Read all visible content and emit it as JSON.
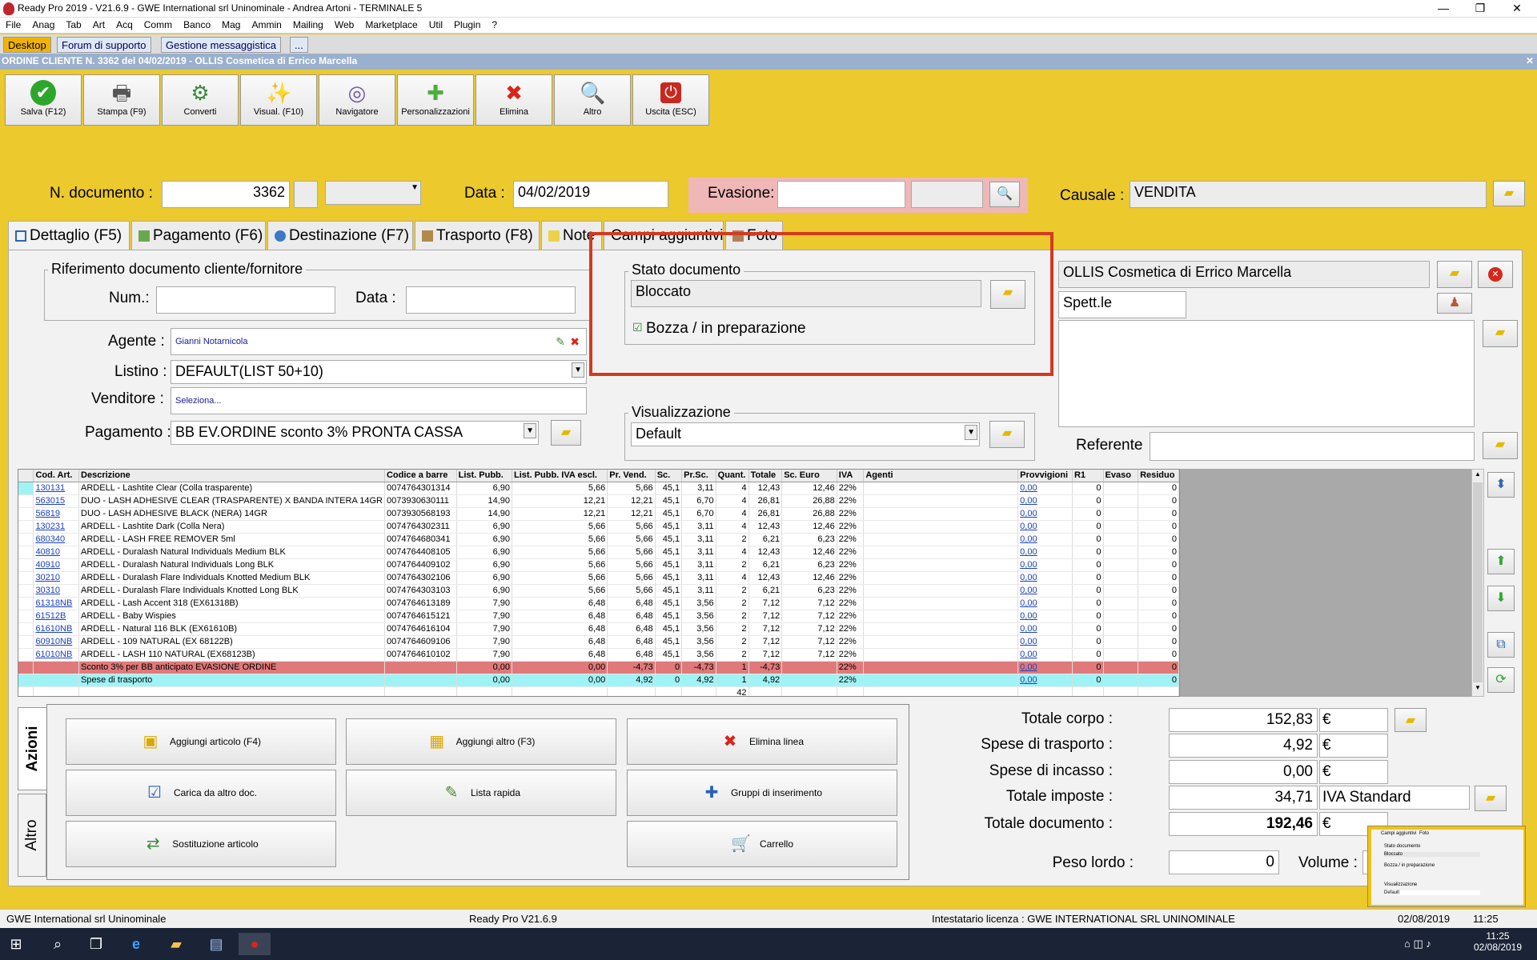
{
  "window": {
    "title": "Ready Pro 2019 - V21.6.9 - GWE International srl Uninominale - Andrea Artoni - TERMINALE 5",
    "min": "—",
    "max": "❐",
    "close": "✕"
  },
  "menu": [
    "File",
    "Anag",
    "Tab",
    "Art",
    "Acq",
    "Comm",
    "Banco",
    "Mag",
    "Ammin",
    "Mailing",
    "Web",
    "Marketplace",
    "Util",
    "Plugin",
    "?"
  ],
  "top_tabs": [
    "Desktop",
    "Forum di supporto",
    "Gestione messaggistica",
    "..."
  ],
  "order_title": "ORDINE CLIENTE N. 3362 del 04/02/2019 - OLLIS Cosmetica di Errico Marcella",
  "order_close": "✕",
  "toolbar": [
    {
      "label": "Salva (F12)",
      "icon": "✔"
    },
    {
      "label": "Stampa (F9)",
      "icon": "🖶"
    },
    {
      "label": "Converti",
      "icon": "⚙"
    },
    {
      "label": "Visual. (F10)",
      "icon": "✨"
    },
    {
      "label": "Navigatore",
      "icon": "◎"
    },
    {
      "label": "Personalizzazioni",
      "icon": "✚"
    },
    {
      "label": "Elimina",
      "icon": "✖"
    },
    {
      "label": "Altro",
      "icon": "🔍"
    },
    {
      "label": "Uscita (ESC)",
      "icon": "⏻"
    }
  ],
  "header": {
    "ndoc_label": "N. documento :",
    "ndoc_value": "3362",
    "data_label": "Data :",
    "data_value": "04/02/2019",
    "evasione_label": "Evasione:",
    "causale_label": "Causale :",
    "causale_value": "VENDITA"
  },
  "form_tabs": [
    "Dettaglio (F5)",
    "Pagamento (F6)",
    "Destinazione (F7)",
    "Trasporto (F8)",
    "Note",
    "Campi aggiuntivi",
    "Foto"
  ],
  "riferimento": {
    "title": "Riferimento documento cliente/fornitore",
    "num_label": "Num.:",
    "data_label": "Data :"
  },
  "agente": {
    "label": "Agente :",
    "value": "Gianni Notarnicola"
  },
  "listino": {
    "label": "Listino :",
    "value": "DEFAULT(LIST 50+10)"
  },
  "venditore": {
    "label": "Venditore :",
    "value": "Seleziona..."
  },
  "pagamento": {
    "label": "Pagamento :",
    "value": "BB EV.ORDINE sconto 3% PRONTA CASSA"
  },
  "stato": {
    "title": "Stato documento",
    "value": "Bloccato",
    "checkbox_label": "Bozza / in preparazione",
    "checkbox_mark": "☑"
  },
  "visualizzazione": {
    "title": "Visualizzazione",
    "value": "Default"
  },
  "cliente": {
    "name": "OLLIS Cosmetica di Errico Marcella",
    "title": "Spett.le",
    "referente_label": "Referente"
  },
  "grid": {
    "columns": [
      "",
      "Cod. Art.",
      "Descrizione",
      "Codice a barre",
      "List. Pubb.",
      "List. Pubb. IVA escl.",
      "Pr. Vend.",
      "Sc.",
      "Pr.Sc.",
      "Quant.",
      "Totale",
      "Sc. Euro",
      "IVA",
      "Agenti",
      "Provvigioni",
      "R1",
      "Evaso",
      "Residuo"
    ],
    "rows": [
      [
        "130131",
        "ARDELL - Lashtite Clear (Colla trasparente)",
        "0074764301314",
        "6,90",
        "5,66",
        "5,66",
        "45,1",
        "3,11",
        "4",
        "12,43",
        "12,46",
        "22%",
        "",
        "0,00",
        "0",
        "",
        "0"
      ],
      [
        "563015",
        "DUO - LASH ADHESIVE CLEAR (TRASPARENTE) X BANDA INTERA 14GR",
        "0073930630111",
        "14,90",
        "12,21",
        "12,21",
        "45,1",
        "6,70",
        "4",
        "26,81",
        "26,88",
        "22%",
        "",
        "0,00",
        "0",
        "",
        "0"
      ],
      [
        "56819",
        "DUO - LASH ADHESIVE BLACK (NERA) 14GR",
        "0073930568193",
        "14,90",
        "12,21",
        "12,21",
        "45,1",
        "6,70",
        "4",
        "26,81",
        "26,88",
        "22%",
        "",
        "0,00",
        "0",
        "",
        "0"
      ],
      [
        "130231",
        "ARDELL - Lashtite Dark (Colla Nera)",
        "0074764302311",
        "6,90",
        "5,66",
        "5,66",
        "45,1",
        "3,11",
        "4",
        "12,43",
        "12,46",
        "22%",
        "",
        "0,00",
        "0",
        "",
        "0"
      ],
      [
        "680340",
        "ARDELL - LASH FREE REMOVER 5ml",
        "0074764680341",
        "6,90",
        "5,66",
        "5,66",
        "45,1",
        "3,11",
        "2",
        "6,21",
        "6,23",
        "22%",
        "",
        "0,00",
        "0",
        "",
        "0"
      ],
      [
        "40810",
        "ARDELL - Duralash Natural Individuals Medium BLK",
        "0074764408105",
        "6,90",
        "5,66",
        "5,66",
        "45,1",
        "3,11",
        "4",
        "12,43",
        "12,46",
        "22%",
        "",
        "0,00",
        "0",
        "",
        "0"
      ],
      [
        "40910",
        "ARDELL - Duralash Natural Individuals  Long BLK",
        "0074764409102",
        "6,90",
        "5,66",
        "5,66",
        "45,1",
        "3,11",
        "2",
        "6,21",
        "6,23",
        "22%",
        "",
        "0,00",
        "0",
        "",
        "0"
      ],
      [
        "30210",
        "ARDELL - Duralash Flare Individuals Knotted Medium BLK",
        "0074764302106",
        "6,90",
        "5,66",
        "5,66",
        "45,1",
        "3,11",
        "4",
        "12,43",
        "12,46",
        "22%",
        "",
        "0,00",
        "0",
        "",
        "0"
      ],
      [
        "30310",
        "ARDELL - Duralash Flare Individuals Knotted Long BLK",
        "0074764303103",
        "6,90",
        "5,66",
        "5,66",
        "45,1",
        "3,11",
        "2",
        "6,21",
        "6,23",
        "22%",
        "",
        "0,00",
        "0",
        "",
        "0"
      ],
      [
        "61318NB",
        "ARDELL - Lash Accent 318 (EX61318B)",
        "0074764613189",
        "7,90",
        "6,48",
        "6,48",
        "45,1",
        "3,56",
        "2",
        "7,12",
        "7,12",
        "22%",
        "",
        "0,00",
        "0",
        "",
        "0"
      ],
      [
        "61512B",
        "ARDELL - Baby Wispies",
        "0074764615121",
        "7,90",
        "6,48",
        "6,48",
        "45,1",
        "3,56",
        "2",
        "7,12",
        "7,12",
        "22%",
        "",
        "0,00",
        "0",
        "",
        "0"
      ],
      [
        "61610NB",
        "ARDELL - Natural 116 BLK (EX61610B)",
        "0074764616104",
        "7,90",
        "6,48",
        "6,48",
        "45,1",
        "3,56",
        "2",
        "7,12",
        "7,12",
        "22%",
        "",
        "0,00",
        "0",
        "",
        "0"
      ],
      [
        "60910NB",
        "ARDELL - 109 NATURAL (EX 68122B)",
        "0074764609106",
        "7,90",
        "6,48",
        "6,48",
        "45,1",
        "3,56",
        "2",
        "7,12",
        "7,12",
        "22%",
        "",
        "0,00",
        "0",
        "",
        "0"
      ],
      [
        "61010NB",
        "ARDELL - LASH 110 NATURAL (EX68123B)",
        "0074764610102",
        "7,90",
        "6,48",
        "6,48",
        "45,1",
        "3,56",
        "2",
        "7,12",
        "7,12",
        "22%",
        "",
        "0,00",
        "0",
        "",
        "0"
      ]
    ],
    "sconto_row": [
      "",
      "Sconto 3% per BB anticipato EVASIONE ORDINE",
      "",
      "0,00",
      "0,00",
      "-4,73",
      "0",
      "-4,73",
      "1",
      "-4,73",
      "",
      "22%",
      "",
      "0,00",
      "0",
      "",
      "0"
    ],
    "spese_row": [
      "",
      "Spese di trasporto",
      "",
      "0,00",
      "0,00",
      "4,92",
      "0",
      "4,92",
      "1",
      "4,92",
      "",
      "22%",
      "",
      "0,00",
      "0",
      "",
      "0"
    ],
    "total_quant": "42"
  },
  "azioni": {
    "tab_label": "Azioni",
    "altro_label": "Altro",
    "buttons": [
      {
        "label": "Aggiungi articolo (F4)",
        "icon": "▣"
      },
      {
        "label": "Aggiungi altro (F3)",
        "icon": "▦"
      },
      {
        "label": "Elimina linea",
        "icon": "✖"
      },
      {
        "label": "Carica da altro doc.",
        "icon": "☑"
      },
      {
        "label": "Lista rapida",
        "icon": "✎"
      },
      {
        "label": "Gruppi di inserimento",
        "icon": "✚"
      },
      {
        "label": "Sostituzione articolo",
        "icon": "⇄"
      },
      {
        "label": "",
        "icon": ""
      },
      {
        "label": "Carrello",
        "icon": "🛒"
      }
    ]
  },
  "totals": {
    "corpo_label": "Totale corpo :",
    "corpo_value": "152,83",
    "trasporto_label": "Spese di trasporto :",
    "trasporto_value": "4,92",
    "incasso_label": "Spese di incasso :",
    "incasso_value": "0,00",
    "imposte_label": "Totale imposte :",
    "imposte_value": "34,71",
    "imposte_type": "IVA Standard",
    "documento_label": "Totale documento :",
    "documento_value": "192,46",
    "currency": "€",
    "peso_label": "Peso lordo :",
    "peso_value": "0",
    "volume_label": "Volume :"
  },
  "status": {
    "company": "GWE International srl Uninominale",
    "version": "Ready Pro V21.6.9",
    "license": "Intestatario licenza : GWE INTERNATIONAL SRL UNINOMINALE",
    "date": "02/08/2019",
    "time": "11:25"
  },
  "taskbar": {
    "time": "11:25",
    "date": "02/08/2019"
  },
  "thumbnail": {
    "tab1": "Campi aggiuntivi",
    "tab2": "Foto",
    "stato": "Stato documento",
    "bloccato": "Bloccato",
    "bozza": "Bozza / in preparazione",
    "vis": "Visualizzazione",
    "default": "Default"
  }
}
